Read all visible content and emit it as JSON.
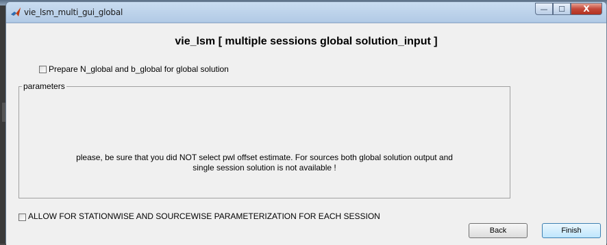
{
  "window": {
    "title": "vie_lsm_multi_gui_global",
    "controls": {
      "minimize": "—",
      "maximize": "☐",
      "close": "X"
    }
  },
  "main": {
    "heading": "vie_lsm [ multiple sessions global solution_input ]",
    "prepare_checkbox": {
      "label": "Prepare N_global and b_global for global solution",
      "checked": false
    },
    "parameters_group": {
      "title": "parameters",
      "notice_line1": "please, be sure that you did NOT select  pwl offset estimate.  For sources both  global solution output and",
      "notice_line2": "single session solution is not available !"
    },
    "allow_checkbox": {
      "label": "ALLOW FOR STATIONWISE AND SOURCEWISE PARAMETERIZATION FOR EACH SESSION",
      "checked": false
    },
    "buttons": {
      "back": "Back",
      "finish": "Finish"
    }
  },
  "colors": {
    "titlebar": "#b3cbe6",
    "client_background": "#f0f0f0",
    "close_button": "#c4483a",
    "default_button": "#bee6fd"
  }
}
